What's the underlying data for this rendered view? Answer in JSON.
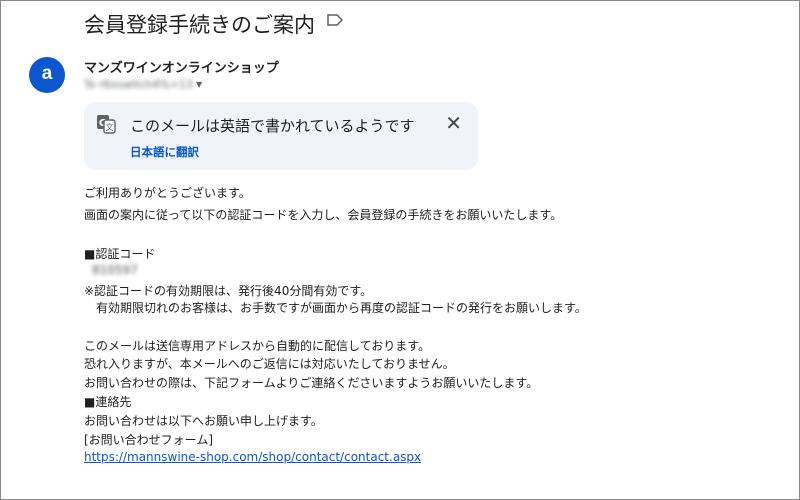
{
  "email": {
    "subject": "会員登録手続きのご案内",
    "sender_name": "マンズワインオンラインショップ",
    "sender_initial": "a",
    "recipient": "To r6xswitch4%=13"
  },
  "translate_banner": {
    "message": "このメールは英語で書かれているようです",
    "action_label": "日本語に翻訳",
    "close_label": "✕"
  },
  "body": {
    "greeting": "ご利用ありがとうございます。",
    "intro": "画面の案内に従って以下の認証コードを入力し、会員登録の手続きをお願いいたします。",
    "code_heading": "■認証コード",
    "code_value": "810597",
    "note1": "※認証コードの有効期限は、発行後40分間有効です。",
    "note2": "　有効期限切れのお客様は、お手数ですが画面から再度の認証コードの発行をお願いします。",
    "auto1": "このメールは送信専用アドレスから自動的に配信しております。",
    "auto2": "恐れ入りますが、本メールへのご返信には対応いたしておりません。",
    "auto3": "お問い合わせの際は、下記フォームよりご連絡くださいますようお願いいたします。",
    "contact_heading": "■連絡先",
    "contact_line": "お問い合わせは以下へお願い申し上げます。",
    "form_label": "[お問い合わせフォーム]",
    "contact_url": "https://mannswine-shop.com/shop/contact/contact.aspx"
  }
}
